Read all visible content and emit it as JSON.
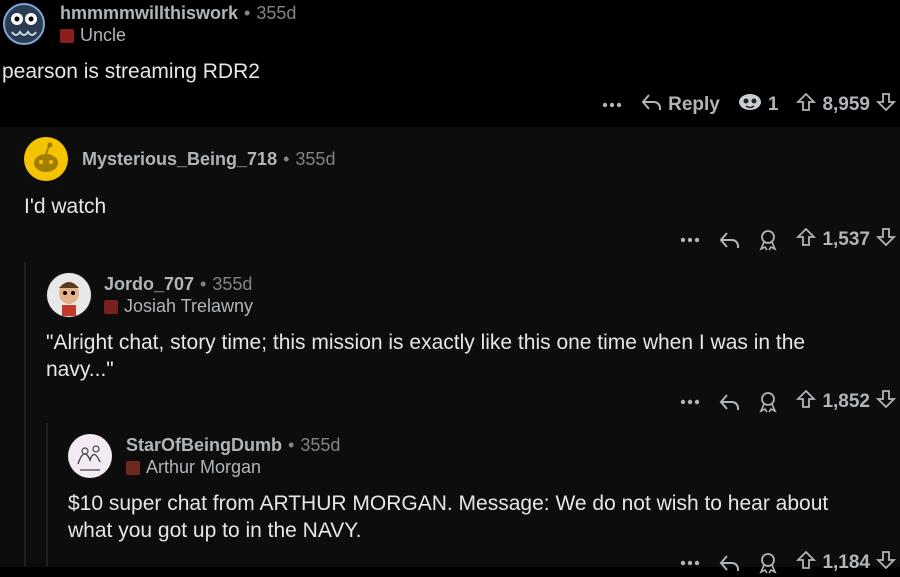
{
  "comments": [
    {
      "username": "hmmmmwillthiswork",
      "age": "355d",
      "flair": "Uncle",
      "body": "pearson is streaming RDR2",
      "actions": {
        "reply_label": "Reply",
        "award_count": "1",
        "score": "8,959"
      }
    },
    {
      "username": "Mysterious_Being_718",
      "age": "355d",
      "body": "I'd watch",
      "actions": {
        "score": "1,537"
      }
    },
    {
      "username": "Jordo_707",
      "age": "355d",
      "flair": "Josiah Trelawny",
      "body": "\"Alright chat, story time; this mission is exactly like this one time when I was in the navy...\"",
      "actions": {
        "score": "1,852"
      }
    },
    {
      "username": "StarOfBeingDumb",
      "age": "355d",
      "flair": "Arthur Morgan",
      "body": "$10 super chat from ARTHUR MORGAN. Message: We do not wish to hear about what you got up to in the NAVY.",
      "actions": {
        "score": "1,184"
      }
    }
  ],
  "colors": {
    "background": "#000000",
    "thread_background": "#0d0d0e",
    "text": "#d7dadc",
    "muted": "#818384",
    "reddit_yellow": "#f5c400"
  },
  "icons": [
    "more-icon",
    "reply-icon",
    "award-icon",
    "upvote-icon",
    "downvote-icon"
  ]
}
